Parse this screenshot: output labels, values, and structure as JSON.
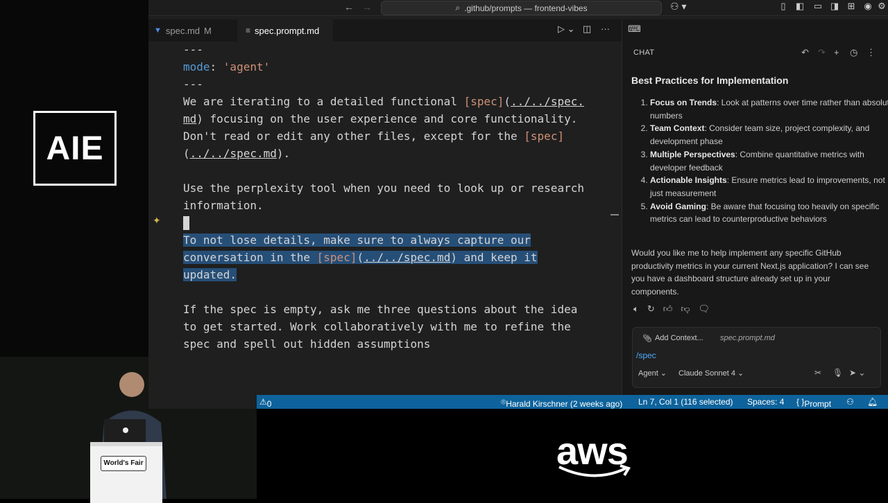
{
  "brand": {
    "logo_text": "AIE"
  },
  "titlebar": {
    "command_center": ".github/prompts — frontend-vibes",
    "icons": [
      "arrow-left-icon",
      "arrow-right-icon",
      "search-icon",
      "copilot-icon",
      "layout-icons",
      "account-icon",
      "gear-icon"
    ]
  },
  "tabs": [
    {
      "label": "spec.md",
      "modified": "M"
    },
    {
      "label": "spec.prompt.md"
    }
  ],
  "editor": {
    "lines": {
      "l0": "---",
      "l1_key": "mode",
      "l1_colon": ": ",
      "l1_val": "'agent'",
      "l2": "---",
      "l3a": "We are iterating to a detailed functional ",
      "l3_br": "[spec]",
      "l3_p1": "(",
      "l3_link": "../../spec.",
      "l4_link": "md",
      "l4b": ") focusing on the user experience and core functionality.",
      "l5a": "Don't read or edit any other files, except for the ",
      "l5_br": "[spec]",
      "l6_p1": "(",
      "l6_link": "../../spec.md",
      "l6b": ").",
      "l8": "Use the perplexity tool when you need to look up or research",
      "l9": "information.",
      "l11": "To not lose details, make sure to always capture our",
      "l12a": "conversation in the ",
      "l12_br": "[spec]",
      "l12_p1": "(",
      "l12_link": "../../spec.md",
      "l12b": ") and keep it",
      "l13": "updated.",
      "l15": "If the spec is empty, ask me three questions about the idea",
      "l16": "to get started. Work collaboratively with me to refine the",
      "l17": "spec and spell out hidden assumptions"
    }
  },
  "chat": {
    "header": "CHAT",
    "title": "Best Practices for Implementation",
    "items": [
      {
        "bold": "Focus on Trends",
        "text": ": Look at patterns over time rather than absolute numbers"
      },
      {
        "bold": "Team Context",
        "text": ": Consider team size, project complexity, and development phase"
      },
      {
        "bold": "Multiple Perspectives",
        "text": ": Combine quantitative metrics with developer feedback"
      },
      {
        "bold": "Actionable Insights",
        "text": ": Ensure metrics lead to improvements, not just measurement"
      },
      {
        "bold": "Avoid Gaming",
        "text": ": Be aware that focusing too heavily on specific metrics can lead to counterproductive behaviors"
      }
    ],
    "closing": "Would you like me to help implement any specific GitHub productivity metrics in your current Next.js application? I can see you have a dashboard structure already set up in your components.",
    "input": {
      "add_context": "Add Context...",
      "context_file": "spec.prompt.md",
      "text": "/spec",
      "mode": "Agent",
      "model": "Claude Sonnet 4"
    }
  },
  "statusbar": {
    "problems": "0",
    "blame": "Harald Kirschner (2 weeks ago)",
    "position": "Ln 7, Col 1 (116 selected)",
    "spaces": "Spaces: 4",
    "language": "Prompt"
  },
  "stage": {
    "podium_label": "World's Fair",
    "sponsor_logo": "aws"
  }
}
